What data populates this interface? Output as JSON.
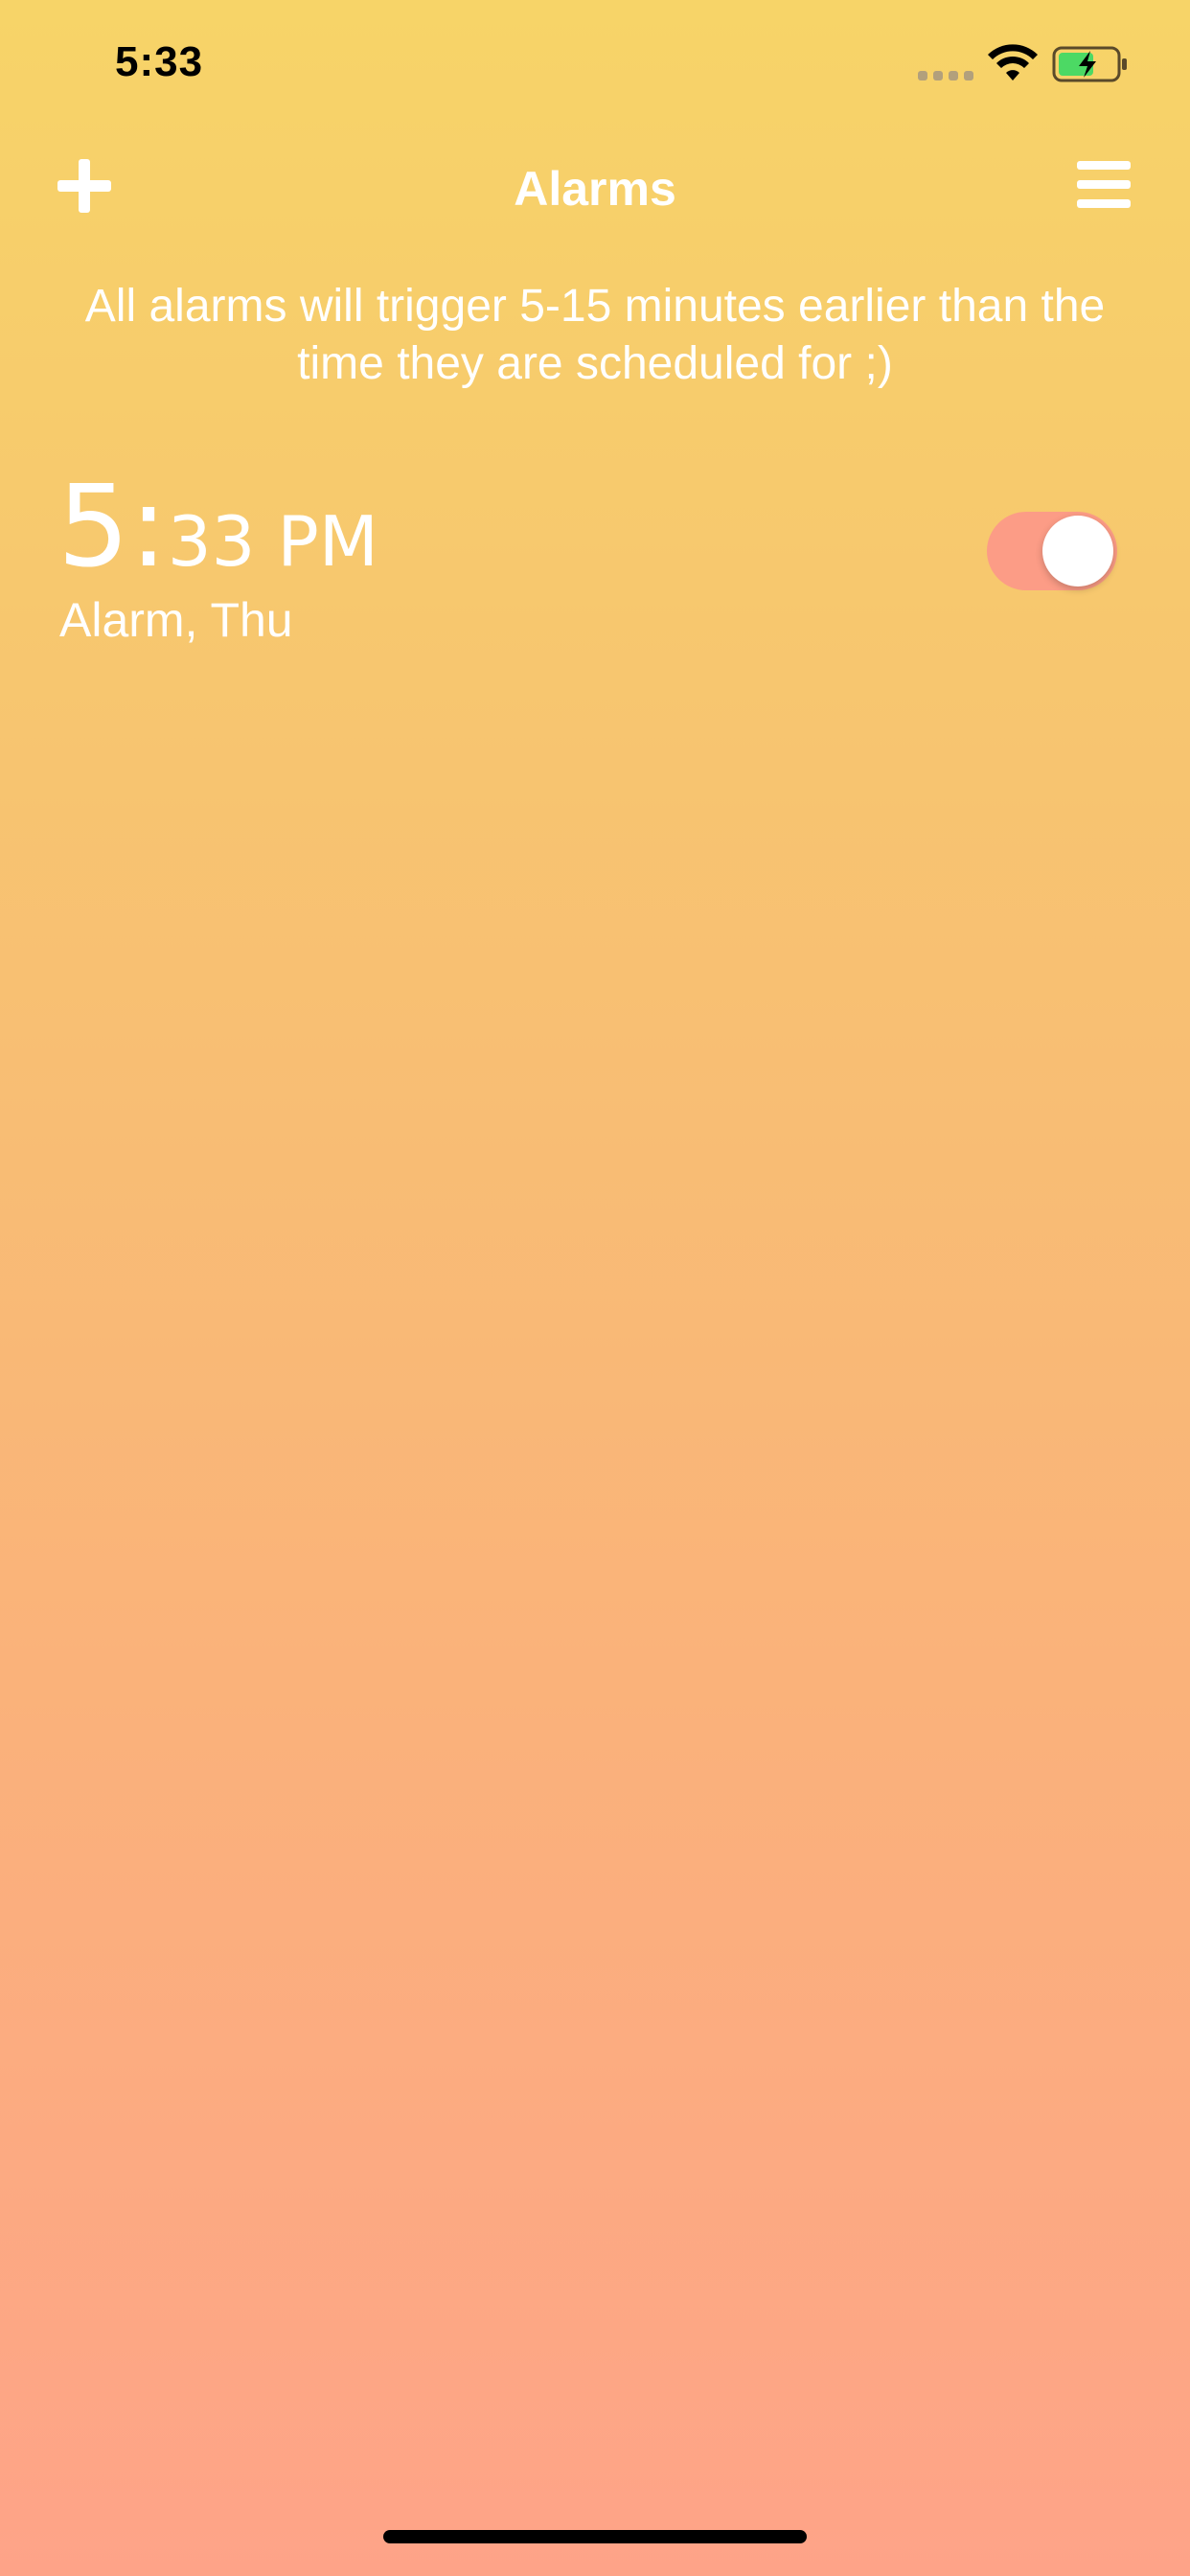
{
  "status_bar": {
    "time": "5:33",
    "icons": [
      "signal-dots",
      "wifi-icon",
      "battery-charging-icon"
    ]
  },
  "nav": {
    "title": "Alarms",
    "add_icon": "plus-icon",
    "menu_icon": "hamburger-menu-icon"
  },
  "notice": "All alarms will trigger 5-15 minutes earlier than the time they are scheduled for ;)",
  "alarms": [
    {
      "hour": "5:",
      "minute_period": "33 PM",
      "label": "Alarm, Thu",
      "enabled": true
    }
  ],
  "colors": {
    "gradient_top": "#F7D468",
    "gradient_bottom": "#FEA388",
    "toggle_on": "#FC9C86",
    "text": "#FFFFFF",
    "battery_fill": "#4CD964"
  }
}
